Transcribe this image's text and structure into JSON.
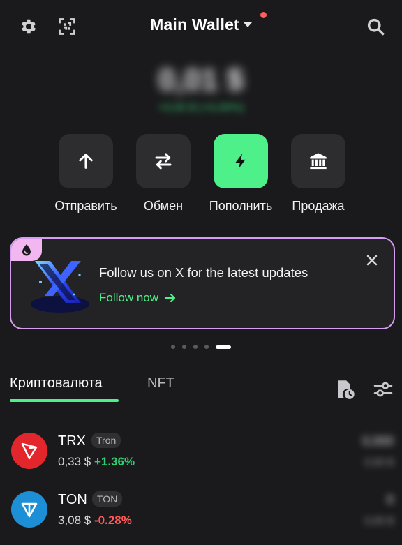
{
  "header": {
    "title": "Main Wallet",
    "left_icons": [
      "gear-icon",
      "scan-icon"
    ],
    "right_icon": "search-icon",
    "notification_color": "#ff5c5c"
  },
  "balance": {
    "amount": "0,01 $",
    "change": "+0,00 $ (+0,00%)",
    "blurred": true
  },
  "actions": [
    {
      "label": "Отправить",
      "icon": "arrow-up-icon"
    },
    {
      "label": "Обмен",
      "icon": "swap-icon"
    },
    {
      "label": "Пополнить",
      "icon": "lightning-icon",
      "primary": true
    },
    {
      "label": "Продажа",
      "icon": "bank-icon"
    }
  ],
  "banner": {
    "title": "Follow us on X for the latest updates",
    "link": "Follow now",
    "tag_icon": "drop-icon",
    "image_icon": "x-logo-icon",
    "border_color": "#d59ef0"
  },
  "pager": {
    "count": 5,
    "active": 5
  },
  "tabs": [
    {
      "label": "Криптовалюта",
      "active": true
    },
    {
      "label": "NFT",
      "active": false
    }
  ],
  "tools": [
    "history-icon",
    "filter-icon"
  ],
  "coins": [
    {
      "symbol": "TRX",
      "network": "Tron",
      "price": "0,33 $",
      "change": "+1.36%",
      "direction": "up",
      "amount": "0,000",
      "value": "0,00 $",
      "logo_color": "#e3262c"
    },
    {
      "symbol": "TON",
      "network": "TON",
      "price": "3,08 $",
      "change": "-0.28%",
      "direction": "down",
      "amount": "0",
      "value": "0,00 $",
      "logo_color": "#1c8fd6"
    }
  ],
  "colors": {
    "accent": "#4ef08a",
    "background": "#1a1a1c",
    "surface": "#2d2d30"
  }
}
